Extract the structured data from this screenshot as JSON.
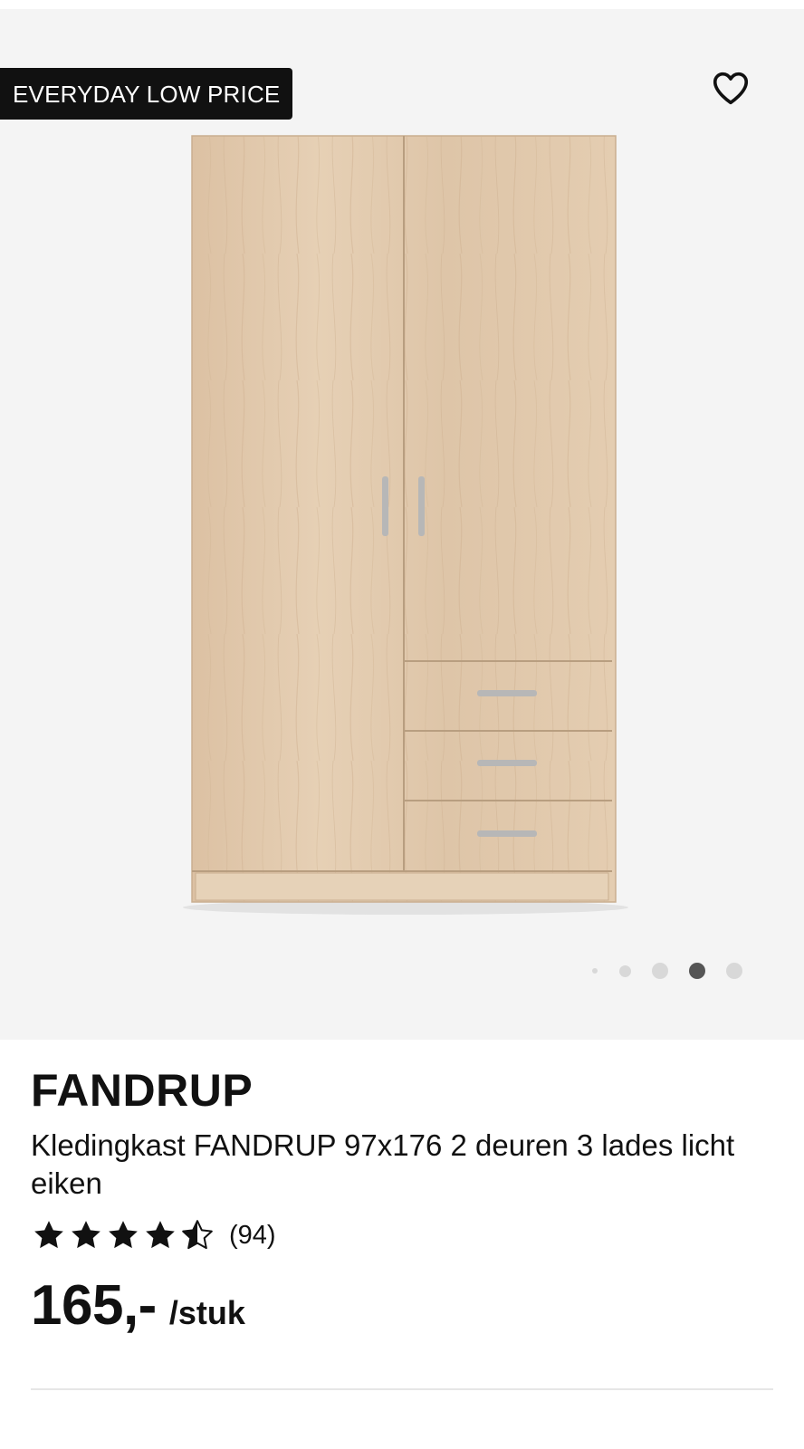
{
  "product": {
    "badge": "EVERYDAY LOW PRICE",
    "brand": "FANDRUP",
    "description": "Kledingkast FANDRUP 97x176 2 deuren 3 lades licht eiken",
    "rating": 4.5,
    "review_count": "(94)",
    "price": "165,-",
    "unit": "/stuk"
  },
  "gallery": {
    "dot_count": 5,
    "active_index": 3
  },
  "icons": {
    "favorite": "heart-icon",
    "star": "star-icon"
  },
  "colors": {
    "badge_bg": "#111111",
    "gallery_bg": "#f4f4f4",
    "dot_active": "#555555",
    "dot_inactive": "#d8d8d8"
  }
}
